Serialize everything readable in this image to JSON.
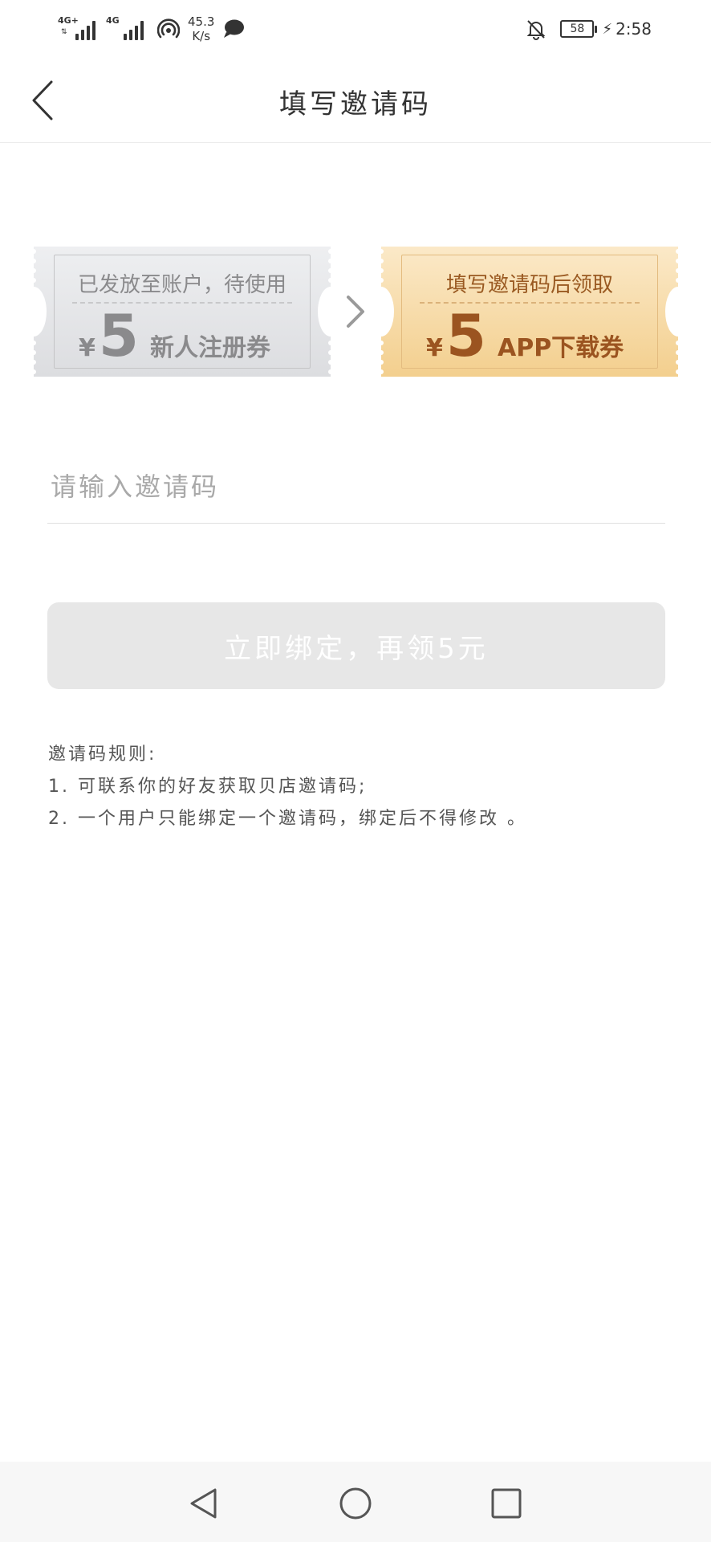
{
  "status_bar": {
    "network_1": "4G+",
    "network_2": "4G",
    "speed_value": "45.3",
    "speed_unit": "K/s",
    "battery": "58",
    "time": "2:58",
    "icons": [
      "signal-icon",
      "wifi-hotspot-icon",
      "chat-notification-icon",
      "bell-muted-icon",
      "battery-icon",
      "charging-icon"
    ]
  },
  "header": {
    "title": "填写邀请码",
    "back_icon": "chevron-left-icon"
  },
  "coupons": {
    "current": {
      "caption": "已发放至账户，待使用",
      "currency": "¥",
      "amount": "5",
      "label": "新人注册券"
    },
    "next": {
      "caption": "填写邀请码后领取",
      "currency": "¥",
      "amount": "5",
      "label": "APP下载券"
    },
    "arrow_icon": "chevron-right-icon"
  },
  "form": {
    "invite_code_value": "",
    "invite_code_placeholder": "请输入邀请码",
    "bind_button_label": "立即绑定，再领5元"
  },
  "rules": {
    "title": "邀请码规则:",
    "items": [
      "1. 可联系你的好友获取贝店邀请码;",
      "2. 一个用户只能绑定一个邀请码，绑定后不得修改 。"
    ]
  },
  "system_nav": {
    "icons": [
      "back-triangle-icon",
      "home-circle-icon",
      "recents-square-icon"
    ]
  },
  "colors": {
    "accent_gold_text": "#9b5420",
    "coupon_gold_bg": "#f6dba8",
    "coupon_gray_bg": "#e6e7e9",
    "button_disabled_bg": "#e7e7e7"
  }
}
